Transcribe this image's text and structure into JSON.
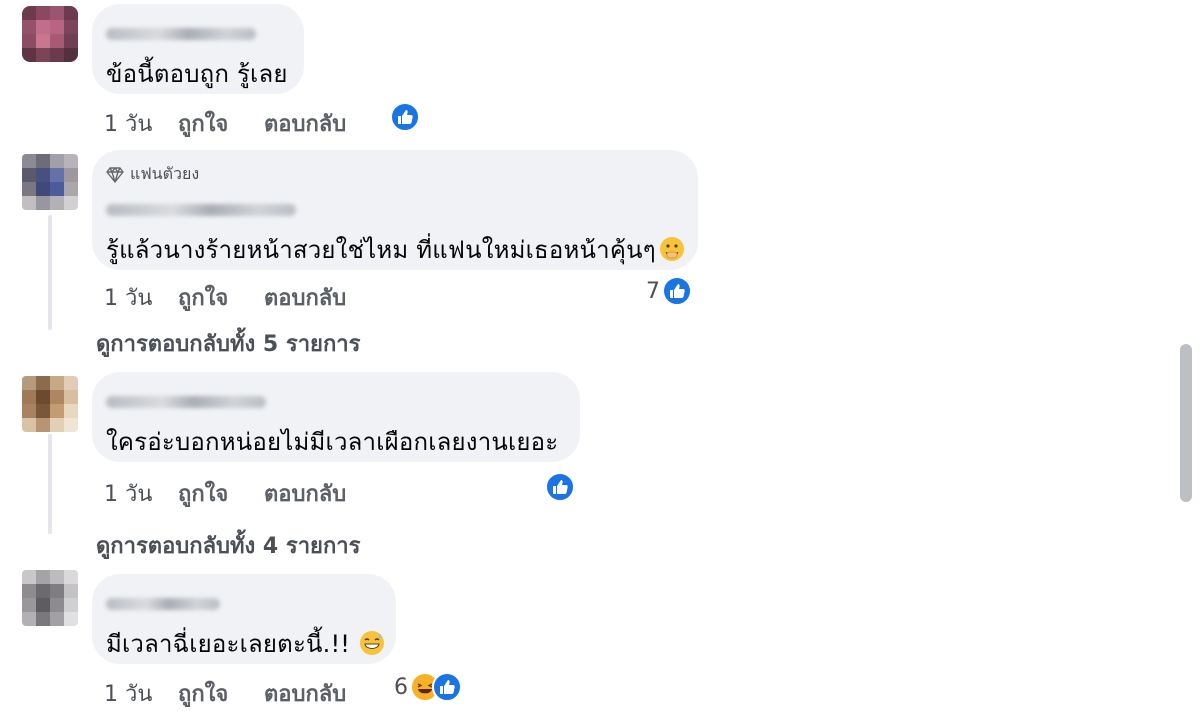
{
  "comments": [
    {
      "text": "ข้อนี้ตอบถูก รู้เลย",
      "time": "1 วัน",
      "like_label": "ถูกใจ",
      "reply_label": "ตอบกลับ",
      "reaction_count": "",
      "reactions": [
        "like-icon"
      ]
    },
    {
      "badge": "แฟนตัวยง",
      "badge_icon": "diamond-icon",
      "text": "รู้แล้วนางร้ายหน้าสวยใช่ไหม ที่แฟนใหม่เธอหน้าคุ้นๆ",
      "text_emoji": "face-with-hand-over-mouth",
      "time": "1 วัน",
      "like_label": "ถูกใจ",
      "reply_label": "ตอบกลับ",
      "reaction_count": "7",
      "reactions": [
        "like-icon"
      ],
      "view_replies": "ดูการตอบกลับทั้ง 5 รายการ"
    },
    {
      "text": "ใครอ่ะบอกหน่อยไม่มีเวลาเผือกเลยงานเยอะ",
      "time": "1 วัน",
      "like_label": "ถูกใจ",
      "reply_label": "ตอบกลับ",
      "reaction_count": "",
      "reactions": [
        "like-icon"
      ],
      "view_replies": "ดูการตอบกลับทั้ง 4 รายการ"
    },
    {
      "text": "มีเวลาฉี่เยอะเลยตะนี้.!!",
      "text_emoji": "grinning-face-with-sweat",
      "time": "1 วัน",
      "like_label": "ถูกใจ",
      "reply_label": "ตอบกลับ",
      "reaction_count": "6",
      "reactions": [
        "haha-icon",
        "like-icon"
      ]
    }
  ],
  "colors": {
    "bubble": "#f0f2f5",
    "like_blue": "#1b74e4",
    "haha_yellow": "#f7b125",
    "meta_text": "#4b4f56"
  }
}
